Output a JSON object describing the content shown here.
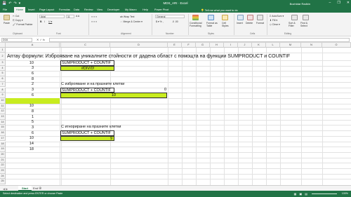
{
  "titlebar": {
    "title": "MDS_ARI · Excel",
    "user": "Bozhidar Radkin",
    "minimize": "–",
    "restore": "❐",
    "close": "✕",
    "qat": [
      "💾",
      "↶",
      "↷",
      "▾"
    ]
  },
  "tabs": [
    "File",
    "Home",
    "Insert",
    "Page Layout",
    "Formulas",
    "Data",
    "Review",
    "View",
    "Developer",
    "My Macro",
    "Help",
    "Power Pivot"
  ],
  "tell_me": "💡 Tell me what you want to do",
  "ribbon": {
    "clipboard": {
      "paste": "Paste",
      "cut": "✂ Cut",
      "copy": "⎘ Copy ▾",
      "format_painter": "🖌 Format Painter",
      "group": "Clipboard"
    },
    "font": {
      "name": "Arial",
      "size": "11",
      "grow": "A A",
      "bold": "B",
      "italic": "I",
      "underline": "U ▾",
      "group": "Font"
    },
    "alignment": {
      "wrap": "ab Wrap Text",
      "merge": "⇔ Merge & Center ▾",
      "group": "Alignment"
    },
    "number": {
      "format": "General",
      "currency": "$ ▾ % ,",
      "decimals": ".0 .00",
      "group": "Number"
    },
    "styles": {
      "conditional": "Conditional Formatting",
      "table": "Format as Table",
      "cell_styles": "Cell Styles",
      "group": "Styles"
    },
    "cells": {
      "insert": "Insert",
      "delete": "Delete",
      "format": "Format",
      "group": "Cells"
    },
    "editing": {
      "autosum": "Σ AutoSum ▾",
      "fill": "⬇ Fill ▾",
      "clear": "◇ Clear ▾",
      "sort": "Sort & Filter",
      "find": "Find & Select",
      "group": "Editing"
    }
  },
  "formula_bar": {
    "name_box": "D16",
    "fx": "✕ ✓ fx",
    "value": ""
  },
  "columns": [
    "A",
    "B",
    "C",
    "D",
    "E",
    "F",
    "G",
    "H",
    "I",
    "J",
    "K",
    "L",
    "M",
    "N",
    "O"
  ],
  "rows": [
    "1",
    "2",
    "3",
    "4",
    "5",
    "6",
    "7",
    "8",
    "9",
    "10",
    "11",
    "12",
    "13",
    "14",
    "15",
    "16",
    "17",
    "18",
    "19",
    "20",
    "21",
    "22",
    "23",
    "24",
    "25",
    "26"
  ],
  "cells": {
    "title": "Arrray формули: Изброяване на уникалните стойности от дадена област с помощта на функции SUMPRODUCT и COUNTIF",
    "col_a": [
      "10",
      "3",
      "6",
      "8",
      "2",
      "3",
      "6",
      "",
      "10",
      "8",
      "1",
      "5",
      "3",
      "6",
      "10",
      "14",
      "18"
    ],
    "block1_header": "SUMPRODUCT + COUNTIF",
    "block1_result": "#DIV/0!",
    "block2_caption": "С изброяване и на празните клетки",
    "block2_header": "SUMPRODUCT + COUNTIF",
    "block2_result": "10",
    "block3_caption": "С игнориране на празните клетки",
    "block3_header": "SUMPRODUCT + COUNTIF",
    "block3_result": "9",
    "stray": "0"
  },
  "sheets": {
    "nav": "◀ ▶",
    "tabs": [
      "Start",
      "End"
    ],
    "add": "⊕"
  },
  "status": {
    "message": "Select destination and press ENTER or choose Paste",
    "zoom": "100%"
  },
  "colors": {
    "accent": "#217346",
    "highlight": "#c8ec1f"
  }
}
